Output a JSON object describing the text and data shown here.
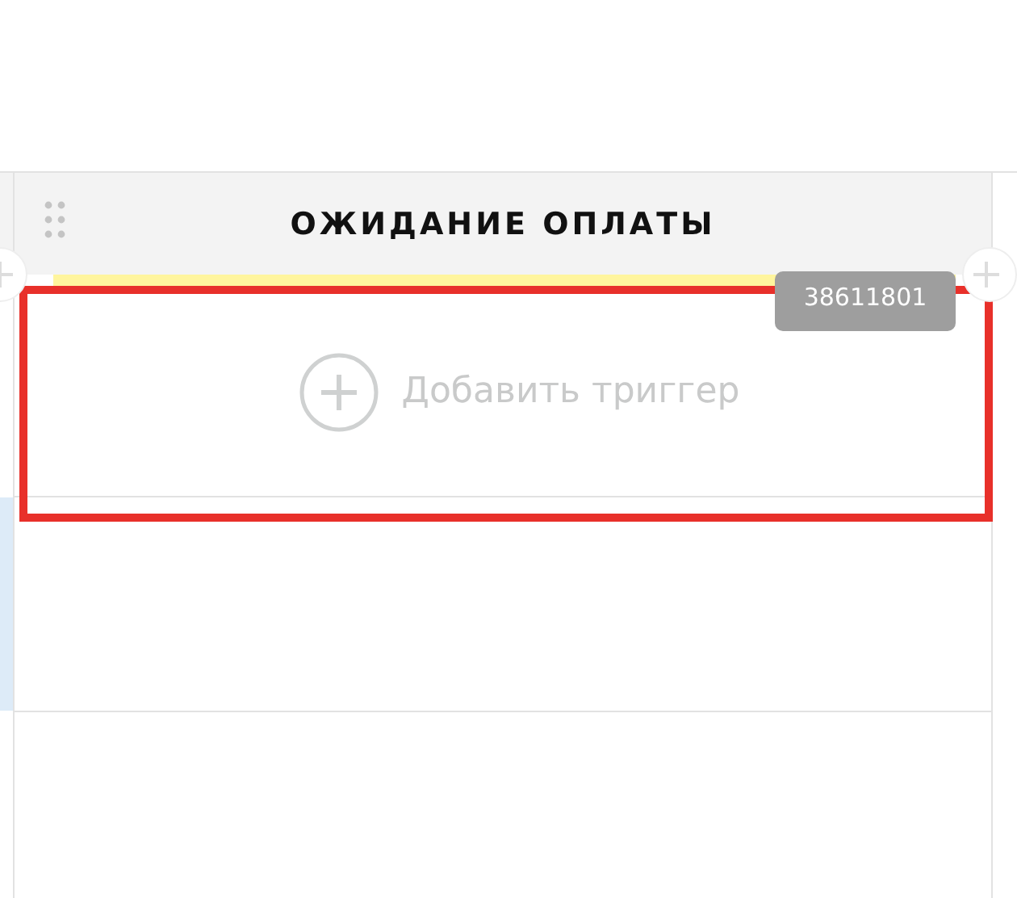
{
  "column": {
    "title": "ОЖИДАНИЕ ОПЛАТЫ",
    "color": "#fff59d",
    "id_badge": "38611801"
  },
  "trigger": {
    "label": "Добавить триггер"
  },
  "highlight": {
    "color": "#e8302a"
  }
}
